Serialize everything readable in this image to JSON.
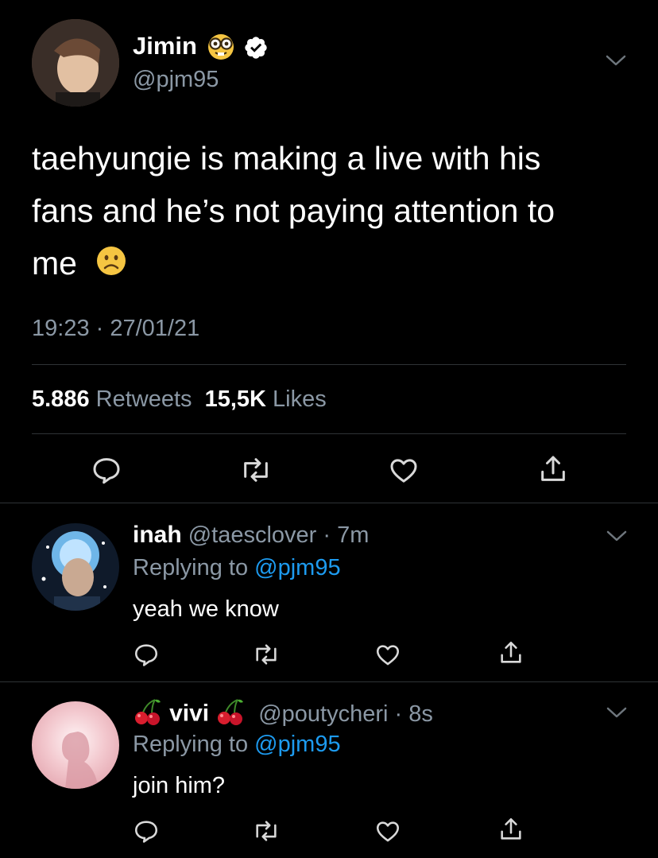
{
  "main_tweet": {
    "author_name": "Jimin",
    "author_handle": "@pjm95",
    "text_line1": "taehyungie is making a live with his",
    "text_line2": "fans and he’s not paying attention to",
    "text_line3": "me",
    "timestamp": "19:23 · 27/01/21",
    "retweets_count": "5.886",
    "retweets_label": "Retweets",
    "likes_count": "15,5K",
    "likes_label": "Likes"
  },
  "replies": [
    {
      "name": "inah",
      "handle_time": "@taesclover · 7m",
      "replying_prefix": "Replying to ",
      "replying_handle": "@pjm95",
      "text": "yeah we know"
    },
    {
      "name": "vivi",
      "handle_time": "@poutycheri · 8s",
      "replying_prefix": "Replying to ",
      "replying_handle": "@pjm95",
      "text": "join him?"
    }
  ],
  "colors": {
    "background": "#000000",
    "muted": "#8b98a5",
    "link": "#1d9bf0",
    "divider": "#2f3336",
    "verified": "#ffffff"
  },
  "icons": [
    "nerd-face-emoji",
    "verified-badge-icon",
    "chevron-down-icon",
    "frowning-face-emoji",
    "reply-icon",
    "retweet-icon",
    "like-icon",
    "share-icon",
    "cherry-emoji"
  ]
}
